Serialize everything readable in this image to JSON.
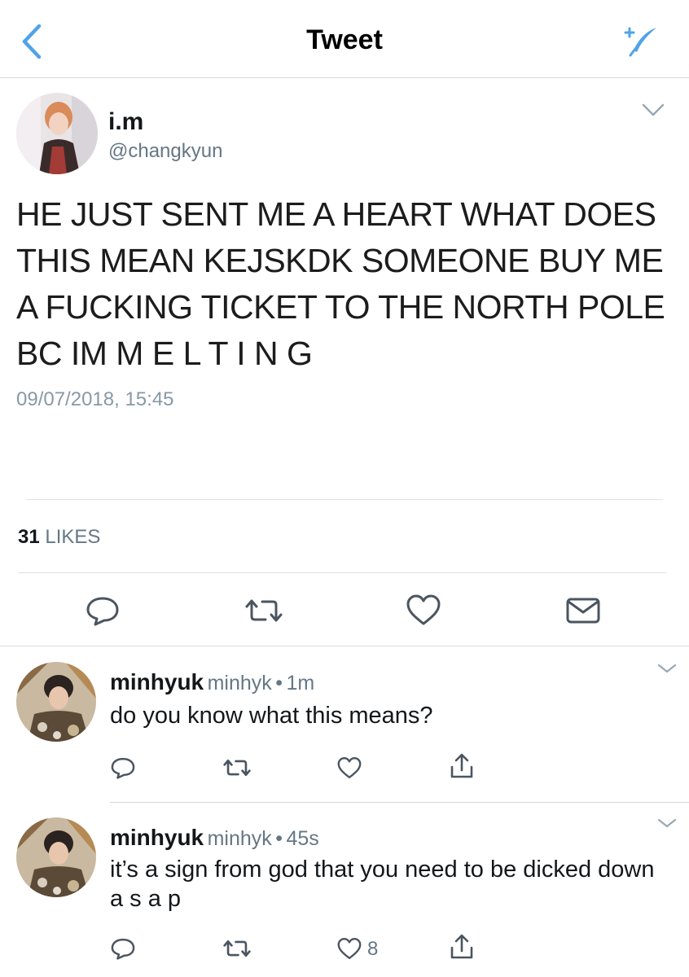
{
  "header": {
    "title": "Tweet",
    "back_icon": "chevron-left-icon",
    "compose_icon": "compose-feather-icon",
    "accent": "#4fa3e9"
  },
  "tweet": {
    "author_name": "i.m",
    "author_handle": "@changkyun",
    "text": "HE JUST SENT ME A HEART WHAT DOES THIS MEAN KEJSKDK SOMEONE BUY ME A FUCKING TICKET TO THE NORTH POLE BC IM M E L T I N G",
    "timestamp": "09/07/2018, 15:45",
    "likes_count": "31",
    "likes_label": "LIKES"
  },
  "replies": [
    {
      "name": "minhyuk",
      "handle": "minhyk",
      "sep": "•",
      "time": "1m",
      "text": "do you know what this means?",
      "like_count": ""
    },
    {
      "name": "minhyuk",
      "handle": "minhyk",
      "sep": "•",
      "time": "45s",
      "text": "it’s a sign from god that you need to be dicked down a s a p",
      "like_count": "8"
    }
  ]
}
